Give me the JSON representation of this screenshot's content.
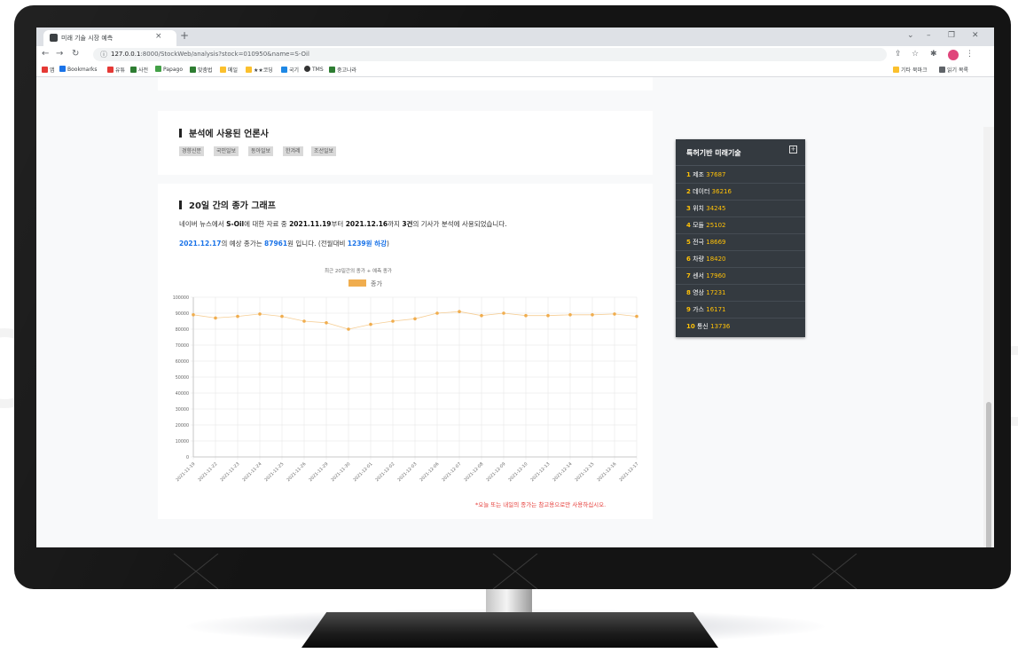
{
  "browser": {
    "tab_title": "미래 기술 시장 예측",
    "tab_close": "×",
    "new_tab": "+",
    "url_prefix": "127.0.0.1",
    "url_rest": ":8000/StockWeb/analysis?stock=010950&name=S-Oil",
    "bookmarks": [
      {
        "label": "앱",
        "color": "#e53935"
      },
      {
        "label": "Bookmarks",
        "color": "#1a73e8"
      },
      {
        "label": "유튜",
        "color": "#e53935"
      },
      {
        "label": "사전",
        "color": "#2e7d32"
      },
      {
        "label": "Papago",
        "color": "#43a047"
      },
      {
        "label": "맞춤법",
        "color": "#2e7d32"
      },
      {
        "label": "메일",
        "color": "#fbc02d"
      },
      {
        "label": "★★코딩",
        "color": "#fbc02d"
      },
      {
        "label": "국기",
        "color": "#1e88e5"
      },
      {
        "label": "TMS",
        "color": "#333333"
      },
      {
        "label": "중고나라",
        "color": "#2e7d32"
      }
    ],
    "bookmarks_right": [
      "기타 북마크",
      "읽기 목록"
    ]
  },
  "sections": {
    "press_title": "분석에 사용된 언론사",
    "press_chips": [
      "경향신문",
      "국민일보",
      "동아일보",
      "한겨레",
      "조선일보"
    ],
    "graph_title": "20일 간의 종가 그래프",
    "desc": {
      "p1": "네이버 뉴스에서 ",
      "stock": "S-Oil",
      "p2": "에 대한 자료 중 ",
      "start": "2021.11.19",
      "p3": "부터 ",
      "end": "2021.12.16",
      "p4": "까지 ",
      "count": "3건",
      "p5": "의 기사가 분석에 사용되었습니다."
    },
    "prediction": {
      "date": "2021.12.17",
      "p1": "의 예상 종가는 ",
      "price": "87961",
      "p2": "원 입니다. (전월대비 ",
      "change": "1239원 하강",
      "p3": ")"
    },
    "note": "*오늘 또는 내일의 종가는 참고용으로만 사용하십시오."
  },
  "sidebar": {
    "title": "특허기반 미래기술",
    "expand_label": "+",
    "items": [
      {
        "rank": "1",
        "name": "제조",
        "count": "37687"
      },
      {
        "rank": "2",
        "name": "데이터",
        "count": "36216"
      },
      {
        "rank": "3",
        "name": "위치",
        "count": "34245"
      },
      {
        "rank": "4",
        "name": "모듈",
        "count": "25102"
      },
      {
        "rank": "5",
        "name": "전극",
        "count": "18669"
      },
      {
        "rank": "6",
        "name": "차량",
        "count": "18420"
      },
      {
        "rank": "7",
        "name": "센서",
        "count": "17960"
      },
      {
        "rank": "8",
        "name": "영상",
        "count": "17231"
      },
      {
        "rank": "9",
        "name": "가스",
        "count": "16171"
      },
      {
        "rank": "10",
        "name": "통신",
        "count": "13736"
      }
    ]
  },
  "colors": {
    "series": "#f0ad4e",
    "accent": "#1a73e8",
    "warning": "#e53935",
    "sidebar_bg": "#343a40",
    "sidebar_accent": "#ffc107"
  },
  "chart_data": {
    "type": "line",
    "title": "최근 20일간의 종가 + 예측 종가",
    "legend": "종가",
    "legend_position": "top",
    "grid": true,
    "ylim": [
      0,
      100000
    ],
    "yticks": [
      0,
      10000,
      20000,
      30000,
      40000,
      50000,
      60000,
      70000,
      80000,
      90000,
      100000
    ],
    "categories": [
      "2021-11-19",
      "2021-11-22",
      "2021-11-23",
      "2021-11-24",
      "2021-11-25",
      "2021-11-26",
      "2021-11-29",
      "2021-11-30",
      "2021-12-01",
      "2021-12-02",
      "2021-12-03",
      "2021-12-06",
      "2021-12-07",
      "2021-12-08",
      "2021-12-09",
      "2021-12-10",
      "2021-12-13",
      "2021-12-14",
      "2021-12-15",
      "2021-12-16",
      "2021-12-17"
    ],
    "series": [
      {
        "name": "종가",
        "values": [
          89000,
          87000,
          88000,
          89500,
          88000,
          85000,
          84000,
          80000,
          83000,
          85000,
          86500,
          90000,
          91000,
          88500,
          90000,
          88500,
          88500,
          89000,
          89000,
          89500,
          88000
        ]
      }
    ]
  }
}
